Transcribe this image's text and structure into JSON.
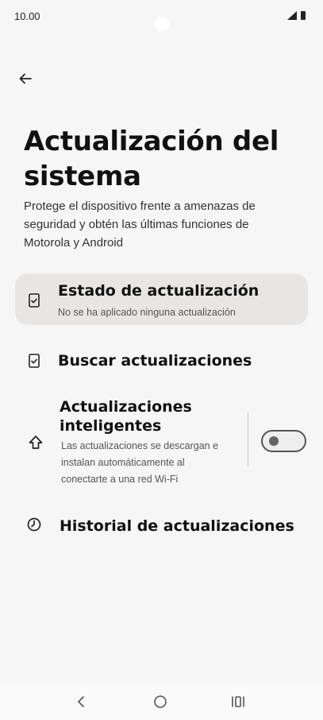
{
  "status_bar": {
    "time": "10.00",
    "icons": [
      "signal-icon",
      "battery-icon"
    ]
  },
  "header": {
    "back_icon": "arrow-left-icon"
  },
  "page": {
    "title": "Actualización del sistema",
    "description": "Protege el dispositivo frente a amenazas de seguridad y obtén las últimas funciones de Motorola y Android"
  },
  "items": {
    "status": {
      "icon": "phone-check-icon",
      "title": "Estado de actualización",
      "subtitle": "No se ha aplicado ninguna actualización"
    },
    "search": {
      "icon": "phone-check-icon",
      "title": "Buscar actualizaciones"
    },
    "smart": {
      "icon": "arrow-up-outline-icon",
      "title": "Actualizaciones inteligentes",
      "subtitle": "Las actualizaciones se descargan e instalan automáticamente al conectarte a una red Wi-Fi",
      "toggle_on": false
    },
    "history": {
      "icon": "clock-icon",
      "title": "Historial de actualizaciones"
    }
  },
  "nav_bar": {
    "buttons": [
      "back-icon",
      "home-icon",
      "recents-icon"
    ]
  },
  "colors": {
    "background": "#f6f6f6",
    "highlight": "#e8e6e4",
    "text": "#111111"
  }
}
